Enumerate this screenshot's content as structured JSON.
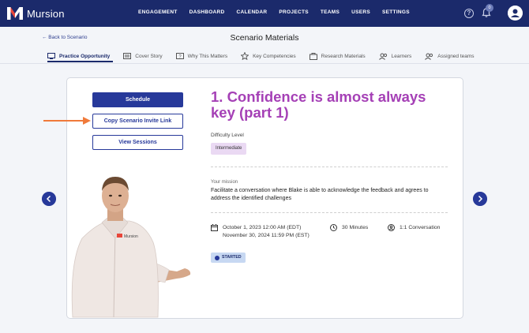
{
  "app": {
    "brand": "Mursion"
  },
  "nav": {
    "items": [
      "ENGAGEMENT",
      "DASHBOARD",
      "CALENDAR",
      "PROJECTS",
      "TEAMS",
      "USERS",
      "SETTINGS"
    ],
    "notification_count": "0"
  },
  "header": {
    "back_label": "← Back to Scenario",
    "title": "Scenario Materials"
  },
  "tabs": [
    {
      "label": "Practice Opportunity",
      "icon": "practice-icon",
      "active": true
    },
    {
      "label": "Cover Story",
      "icon": "cover-story-icon"
    },
    {
      "label": "Why This Matters",
      "icon": "why-matters-icon"
    },
    {
      "label": "Key Competencies",
      "icon": "competencies-icon"
    },
    {
      "label": "Research Materials",
      "icon": "research-icon"
    },
    {
      "label": "Learners",
      "icon": "learners-icon"
    },
    {
      "label": "Assigned teams",
      "icon": "teams-icon"
    }
  ],
  "actions": {
    "schedule": "Schedule",
    "copy_link": "Copy Scenario Invite Link",
    "view_sessions": "View Sessions"
  },
  "scenario": {
    "title": "1. Confidence is almost always key (part 1)",
    "difficulty_label": "Difficulty Level",
    "difficulty": "Intermediate",
    "mission_label": "Your mission",
    "mission": "Facilitate a conversation where Blake is able to acknowledge the feedback and agrees to address the identified challenges",
    "date_start": "October 1, 2023 12:00 AM (EDT)",
    "date_end": "November 30, 2024 11:59 PM (EST)",
    "duration": "30 Minutes",
    "conversation": "1:1 Conversation",
    "status": "STARTED"
  },
  "colors": {
    "nav_bg": "#1b2a6b",
    "primary": "#27399a",
    "title": "#a540b6",
    "arrow": "#f07a3a"
  }
}
